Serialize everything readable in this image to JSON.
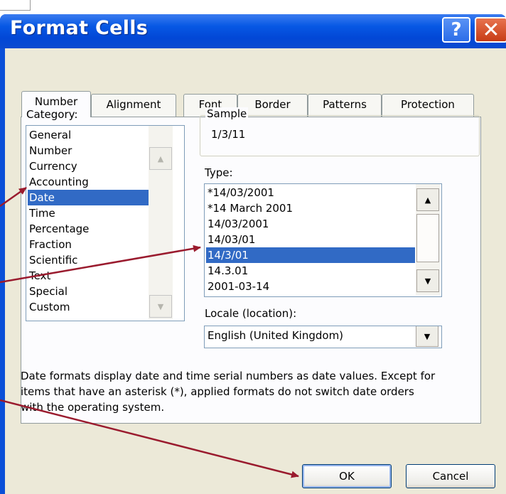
{
  "window": {
    "title": "Format Cells",
    "help_icon": "?",
    "close_icon": "✕"
  },
  "tabs": [
    "Number",
    "Alignment",
    "Font",
    "Border",
    "Patterns",
    "Protection"
  ],
  "category": {
    "label": "Category:",
    "items": [
      "General",
      "Number",
      "Currency",
      "Accounting",
      "Date",
      "Time",
      "Percentage",
      "Fraction",
      "Scientific",
      "Text",
      "Special",
      "Custom"
    ],
    "selected": "Date"
  },
  "sample": {
    "label": "Sample",
    "value": "1/3/11"
  },
  "type": {
    "label": "Type:",
    "items": [
      "*14/03/2001",
      "*14 March 2001",
      "14/03/2001",
      "14/03/01",
      "14/3/01",
      "14.3.01",
      "2001-03-14"
    ],
    "selected": "14/3/01"
  },
  "locale": {
    "label": "Locale (location):",
    "value": "English (United Kingdom)"
  },
  "description": {
    "line1": "Date formats display date and time serial numbers as date values.  Except for",
    "line2": "items that have an asterisk (*), applied formats do not switch date orders",
    "line3": "with the operating system."
  },
  "buttons": {
    "ok": "OK",
    "cancel": "Cancel"
  },
  "colors": {
    "titlebar": "#0247d6",
    "selection": "#316ac5",
    "dialog_bg": "#ece9d8",
    "annotation_arrow": "#9a1b2e"
  }
}
